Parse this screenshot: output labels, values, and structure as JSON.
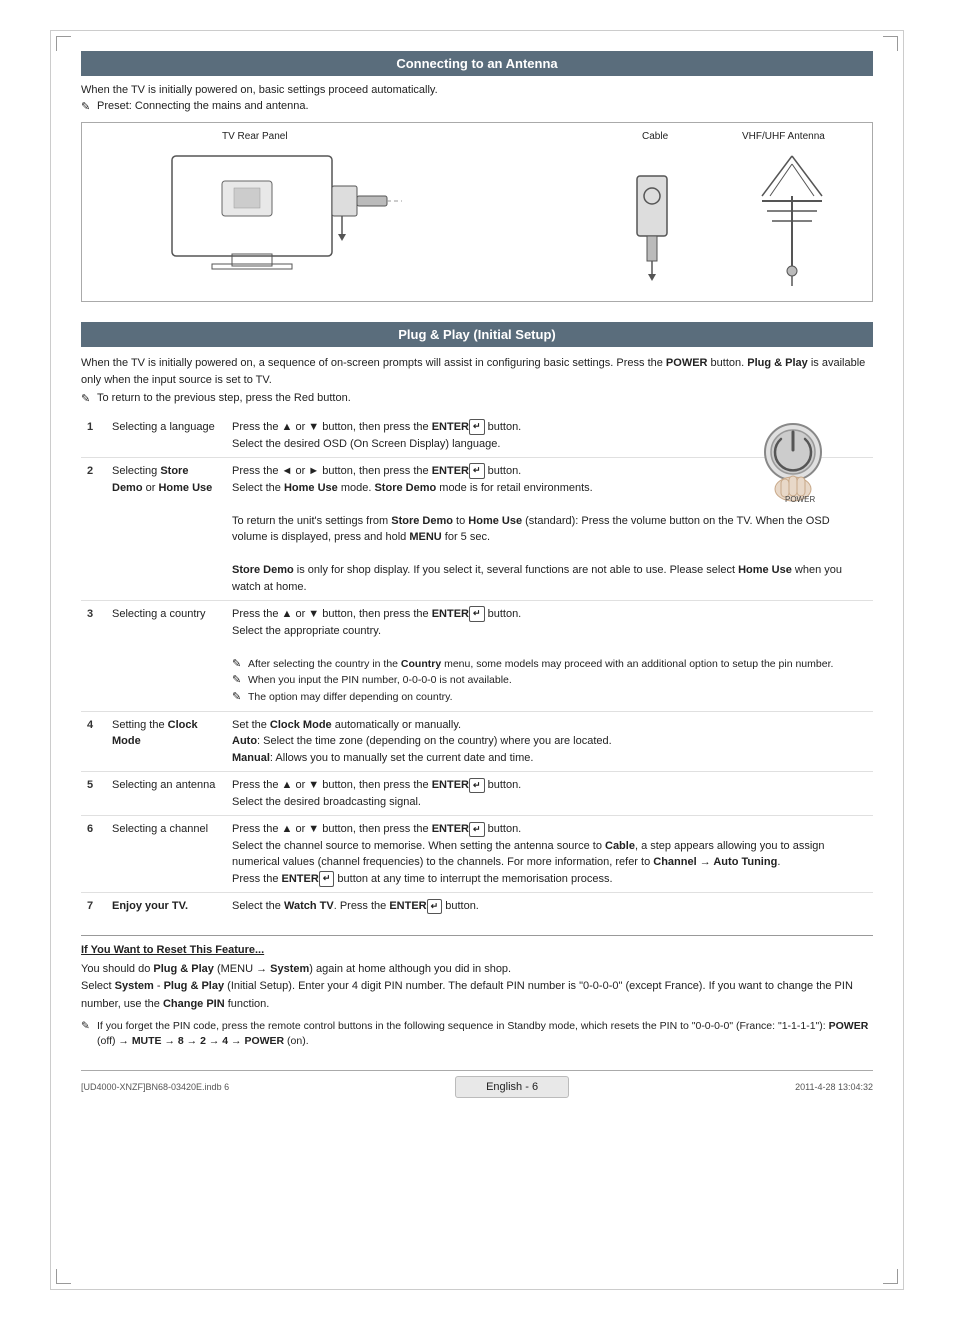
{
  "page": {
    "corner_marks": true
  },
  "section1": {
    "title": "Connecting to an Antenna",
    "intro": "When the TV is initially powered on, basic settings proceed automatically.",
    "note": "Preset: Connecting the mains and antenna.",
    "diagram": {
      "tv_panel_label": "TV Rear Panel",
      "cable_label": "Cable",
      "vhf_label": "VHF/UHF Antenna"
    }
  },
  "section2": {
    "title": "Plug & Play (Initial Setup)",
    "intro": "When the TV is initially powered on, a sequence of on-screen prompts will assist in configuring basic settings. Press the POWER button. Plug & Play is available only when the input source is set to TV.",
    "note": "To return to the previous step, press the Red button.",
    "steps": [
      {
        "number": "1",
        "label": "Selecting a language",
        "content_lines": [
          "Press the ▲ or ▼ button, then press the ENTER button.",
          "Select the desired OSD (On Screen Display) language."
        ],
        "notes": []
      },
      {
        "number": "2",
        "label": "Selecting Store Demo or Home Use",
        "content_lines": [
          "Press the ◄ or ► button, then press the ENTER button.",
          "Select the Home Use mode. Store Demo mode is for retail environments.",
          "To return the unit's settings from Store Demo to Home Use (standard): Press the volume button on the TV. When the OSD volume is displayed, press and hold MENU for 5 sec.",
          "Store Demo is only for shop display. If you select it, several functions are not able to use. Please select Home Use when you watch at home."
        ],
        "notes": []
      },
      {
        "number": "3",
        "label": "Selecting country",
        "content_lines": [
          "Press the ▲ or ▼ button, then press the ENTER button.",
          "Select the appropriate country."
        ],
        "notes": [
          "After selecting the country in the Country menu, some models may proceed with an additional option to setup the pin number.",
          "When you input the PIN number, 0-0-0-0 is not available.",
          "The option may differ depending on country."
        ]
      },
      {
        "number": "4",
        "label": "Setting the Clock Mode",
        "content_lines": [
          "Set the Clock Mode automatically or manually.",
          "Auto: Select the time zone (depending on the country) where you are located.",
          "Manual: Allows you to manually set the current date and time."
        ],
        "notes": []
      },
      {
        "number": "5",
        "label": "Selecting an antenna",
        "content_lines": [
          "Press the ▲ or ▼ button, then press the ENTER button.",
          "Select the desired broadcasting signal."
        ],
        "notes": []
      },
      {
        "number": "6",
        "label": "Selecting channel",
        "content_lines": [
          "Press the ▲ or ▼ button, then press the ENTER button.",
          "Select the channel source to memorise. When setting the antenna source to Cable, a step appears allowing you to assign numerical values (channel frequencies) to the channels. For more information, refer to Channel → Auto Tuning.",
          "Press the ENTER button at any time to interrupt the memorisation process."
        ],
        "notes": []
      },
      {
        "number": "7",
        "label": "Enjoy your TV.",
        "content_lines": [
          "Select the Watch TV. Press the ENTER button."
        ],
        "notes": []
      }
    ]
  },
  "reset_section": {
    "title": "If You Want to Reset This Feature...",
    "lines": [
      "You should do Plug & Play (MENU → System) again at home although you did in shop.",
      "Select System - Plug & Play (Initial Setup). Enter your 4 digit PIN number. The default PIN number is \"0-0-0-0\" (except France). If you want to change the PIN number, use the Change PIN function.",
      "If you forget the PIN code, press the remote control buttons in the following sequence in Standby mode, which resets the PIN to \"0-0-0-0\" (France: \"1-1-1-1\"): POWER (off) → MUTE → 8 → 2 → 4 → POWER (on)."
    ]
  },
  "footer": {
    "left": "[UD4000-XNZF]BN68-03420E.indb   6",
    "center": "English - 6",
    "right": "2011-4-28   13:04:32"
  }
}
